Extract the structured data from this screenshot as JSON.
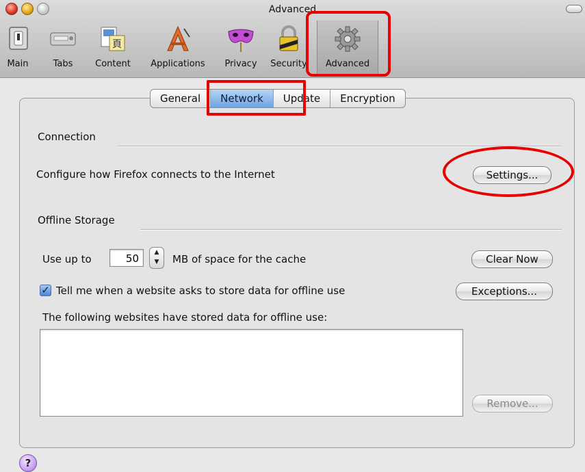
{
  "window": {
    "title": "Advanced"
  },
  "toolbar": {
    "items": [
      {
        "label": "Main",
        "icon": "switch-icon"
      },
      {
        "label": "Tabs",
        "icon": "tabs-icon"
      },
      {
        "label": "Content",
        "icon": "content-icon"
      },
      {
        "label": "Applications",
        "icon": "applications-icon"
      },
      {
        "label": "Privacy",
        "icon": "mask-icon"
      },
      {
        "label": "Security",
        "icon": "lock-icon"
      },
      {
        "label": "Advanced",
        "icon": "gear-icon"
      }
    ],
    "selected": "Advanced"
  },
  "tabs": [
    {
      "label": "General"
    },
    {
      "label": "Network"
    },
    {
      "label": "Update"
    },
    {
      "label": "Encryption"
    }
  ],
  "active_tab": "Network",
  "connection": {
    "title": "Connection",
    "description": "Configure how Firefox connects to the Internet",
    "settings_button": "Settings..."
  },
  "offline": {
    "title": "Offline Storage",
    "use_up_to": "Use up to",
    "cache_value": "50",
    "cache_suffix": "MB of space for the cache",
    "clear_now_button": "Clear Now",
    "tell_me_label": "Tell me when a website asks to store data for offline use",
    "tell_me_checked": true,
    "exceptions_button": "Exceptions...",
    "list_label": "The following websites have stored data for offline use:",
    "remove_button": "Remove..."
  },
  "help_button": "?",
  "colors": {
    "annotation": "#e60000",
    "selected_tab": "#6ea3e3"
  }
}
